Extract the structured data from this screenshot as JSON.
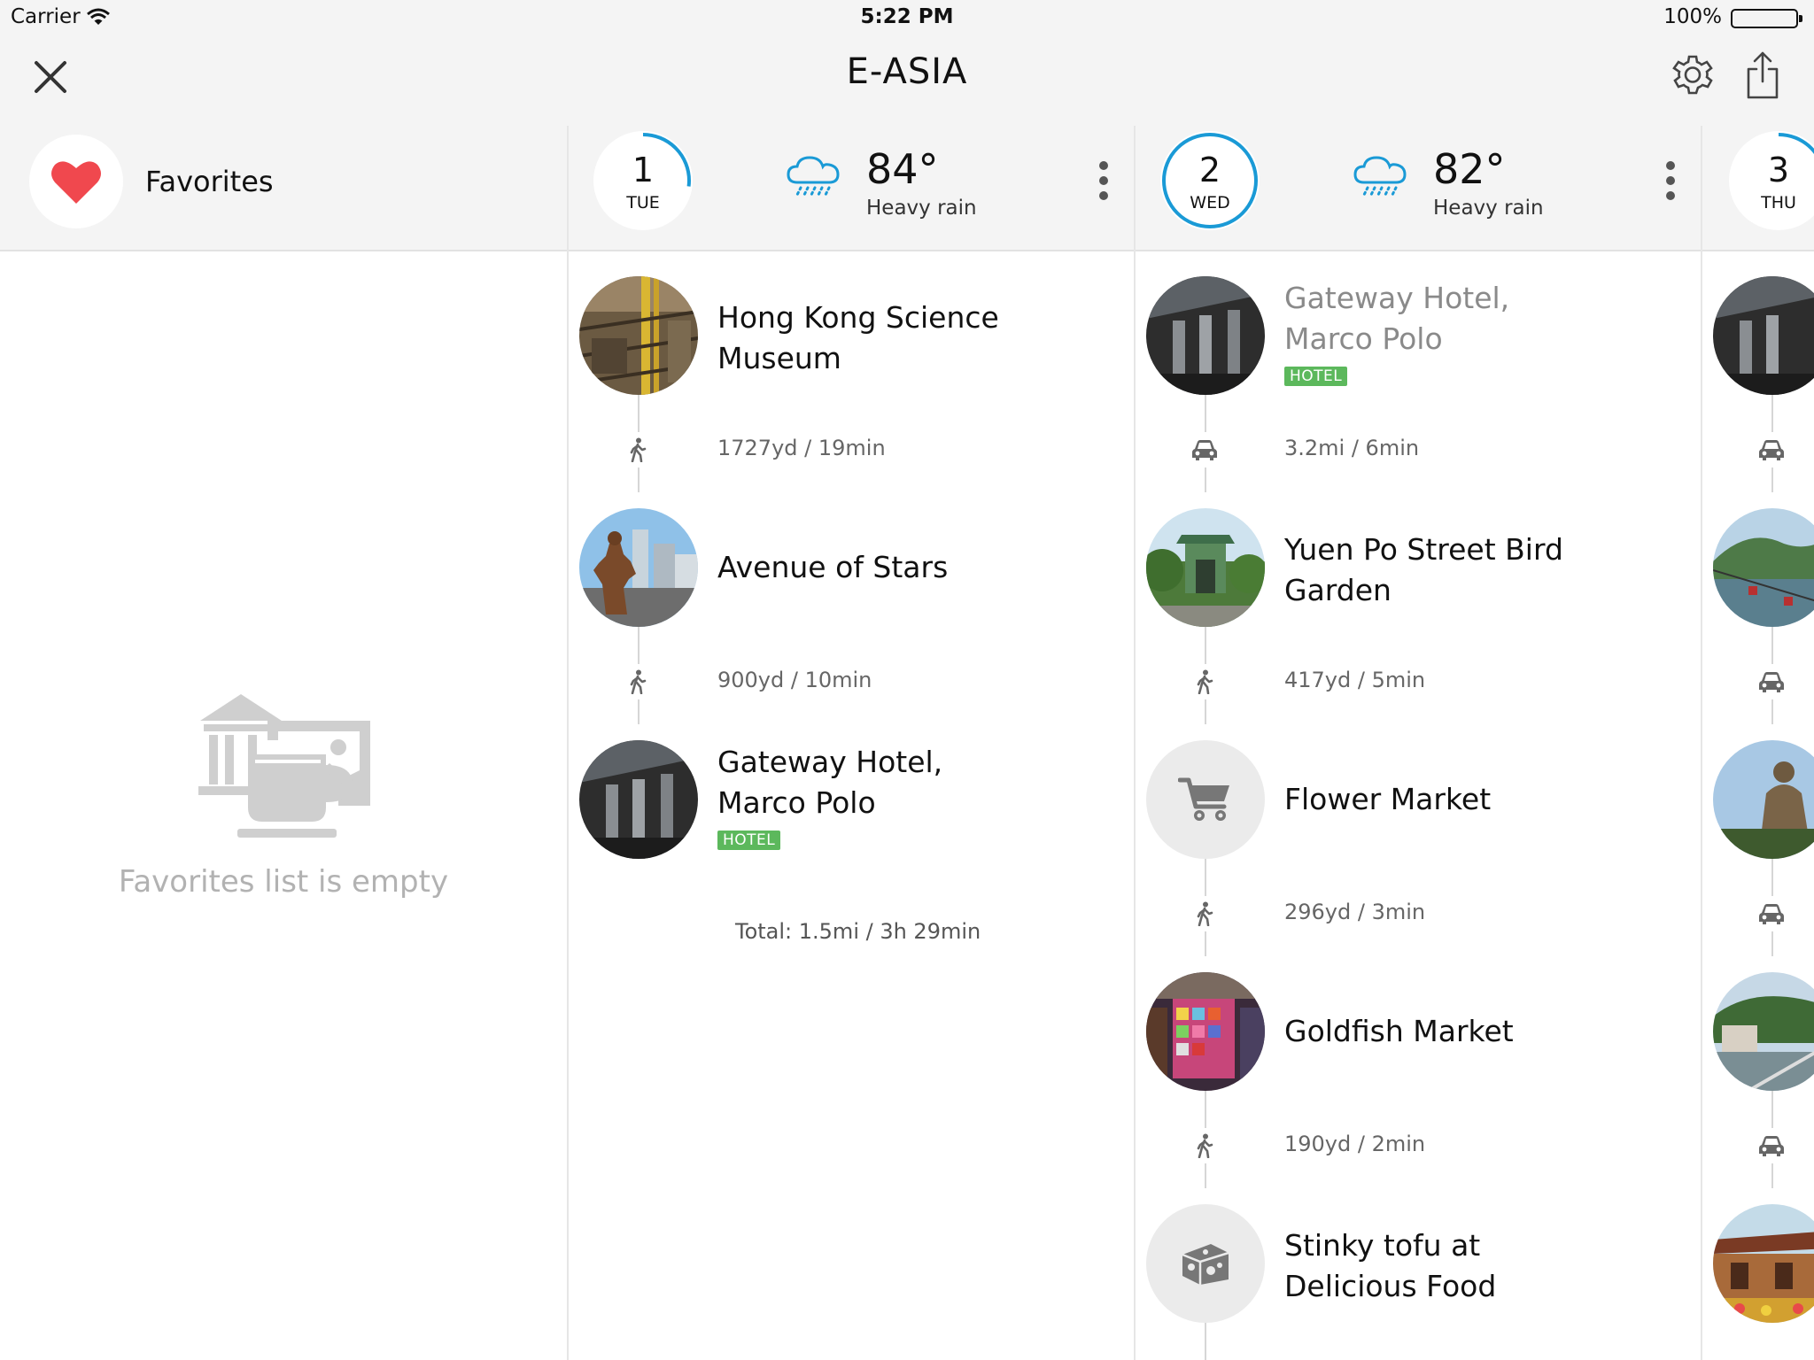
{
  "status_bar": {
    "carrier": "Carrier",
    "time": "5:22 PM",
    "battery": "100%"
  },
  "nav": {
    "title": "E-ASIA"
  },
  "favorites": {
    "label": "Favorites",
    "empty_text": "Favorites list is empty"
  },
  "days": [
    {
      "number": "1",
      "weekday": "TUE",
      "temperature": "84°",
      "condition": "Heavy rain",
      "progress": 0.27
    },
    {
      "number": "2",
      "weekday": "WED",
      "temperature": "82°",
      "condition": "Heavy rain",
      "progress": 1.0
    },
    {
      "number": "3",
      "weekday": "THU",
      "progress": 0.25
    }
  ],
  "day1": {
    "places": [
      {
        "name": "Hong Kong Science Museum"
      },
      {
        "name": "Avenue of Stars"
      },
      {
        "name": "Gateway Hotel, Marco Polo",
        "badge": "HOTEL"
      }
    ],
    "legs": [
      {
        "mode": "walk",
        "text": "1727yd / 19min"
      },
      {
        "mode": "walk",
        "text": "900yd / 10min"
      }
    ],
    "total": "Total: 1.5mi / 3h 29min"
  },
  "day2": {
    "places": [
      {
        "name": "Gateway Hotel, Marco Polo",
        "badge": "HOTEL"
      },
      {
        "name": "Yuen Po Street Bird Garden"
      },
      {
        "name": "Flower Market"
      },
      {
        "name": "Goldfish Market"
      },
      {
        "name": "Stinky tofu at Delicious Food"
      }
    ],
    "legs": [
      {
        "mode": "car",
        "text": "3.2mi / 6min"
      },
      {
        "mode": "walk",
        "text": "417yd / 5min"
      },
      {
        "mode": "walk",
        "text": "296yd / 3min"
      },
      {
        "mode": "walk",
        "text": "190yd / 2min"
      }
    ]
  },
  "colors": {
    "accent": "#1a9ad6",
    "heart": "#f0484e",
    "hotel_badge": "#5cb85c"
  }
}
